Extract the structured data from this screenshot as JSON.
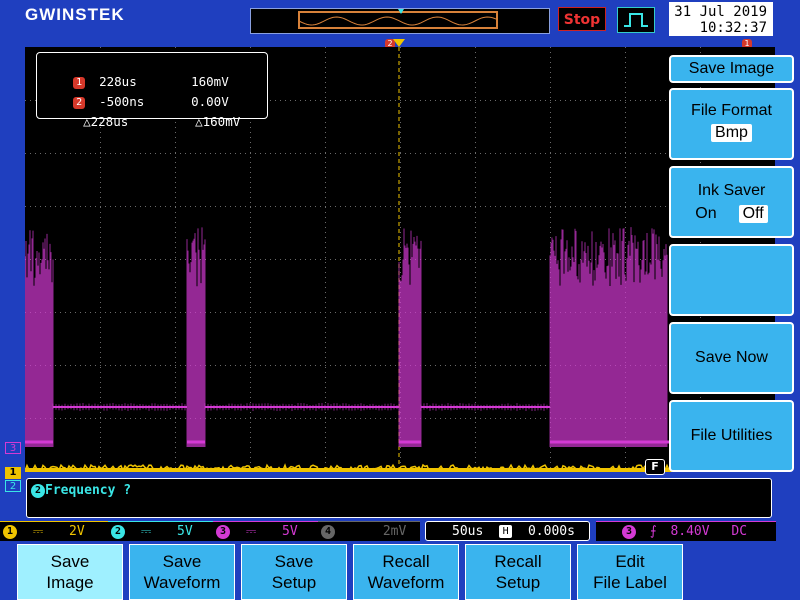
{
  "brand": "GWINSTEK",
  "run_state": "Stop",
  "clock": {
    "date": "31 Jul 2019",
    "time": "10:32:37"
  },
  "cursor": {
    "row1": {
      "ch": "1",
      "time": "228us",
      "volt": "160mV"
    },
    "row2": {
      "ch": "2",
      "time": "-500ns",
      "volt": "0.00V"
    },
    "row3": {
      "dtime": "△228us",
      "dvolt": "△160mV"
    }
  },
  "markers": {
    "left_ch3": "3",
    "left_ch1": "1",
    "left_ch2": "2",
    "top_trig": "2",
    "top_right": "1",
    "filter": "F"
  },
  "status": {
    "message": "Frequency ?",
    "msg_badge": "2"
  },
  "channels": [
    {
      "num": "1",
      "coupling": "⎓",
      "scale": "2V",
      "color": "#f0c400",
      "enabled": true
    },
    {
      "num": "2",
      "coupling": "⎓",
      "scale": "5V",
      "color": "#3ae6e6",
      "enabled": true
    },
    {
      "num": "3",
      "coupling": "⎓",
      "scale": "5V",
      "color": "#d43ad4",
      "enabled": true
    },
    {
      "num": "4",
      "coupling": "",
      "scale": "2mV",
      "color": "#666666",
      "enabled": false
    }
  ],
  "timebase": {
    "scale": "50us",
    "h_icon": "H",
    "position": "0.000s"
  },
  "trigger": {
    "source": "3",
    "slope": "⨍",
    "level": "8.40V",
    "coupling": "DC"
  },
  "side_menu": {
    "title": "Save Image",
    "file_format": {
      "label": "File Format",
      "value": "Bmp"
    },
    "ink_saver": {
      "label": "Ink Saver",
      "on": "On",
      "off": "Off",
      "selected": "Off"
    },
    "save_now": "Save Now",
    "file_utilities": "File Utilities"
  },
  "bottom_menu": [
    {
      "line1": "Save",
      "line2": "Image",
      "active": true
    },
    {
      "line1": "Save",
      "line2": "Waveform",
      "active": false
    },
    {
      "line1": "Save",
      "line2": "Setup",
      "active": false
    },
    {
      "line1": "Recall",
      "line2": "Waveform",
      "active": false
    },
    {
      "line1": "Recall",
      "line2": "Setup",
      "active": false
    },
    {
      "line1": "Edit",
      "line2": "File Label",
      "active": false
    }
  ],
  "colors": {
    "ch1": "#f0c400",
    "ch2": "#3ae6e6",
    "ch3": "#d43ad4",
    "menu": "#3ab4ee",
    "bezel": "#1f3fbf"
  }
}
